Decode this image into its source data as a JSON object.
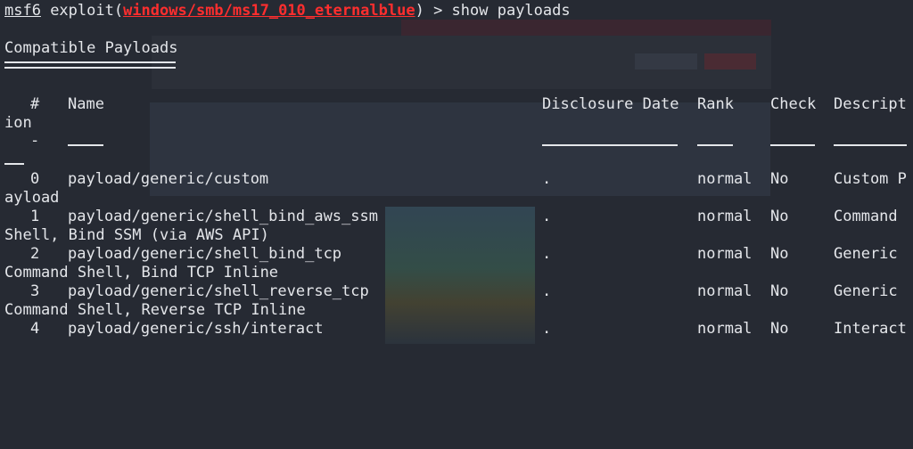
{
  "prompt": {
    "user": "msf6",
    "pre": " exploit(",
    "module": "windows/smb/ms17_010_eternalblue",
    "post": ") > ",
    "command": "show payloads"
  },
  "section_title": "Compatible Payloads",
  "columns": {
    "num": "#",
    "name": "Name",
    "date": "Disclosure Date",
    "rank": "Rank",
    "check": "Check",
    "desc": "Descript",
    "desc_wrap": "ion"
  },
  "sep_minus": "-",
  "rows": [
    {
      "num": "0",
      "name": "payload/generic/custom",
      "date": ".",
      "rank": "normal",
      "check": "No",
      "desc": "Custom P",
      "desc_wrap": "ayload"
    },
    {
      "num": "1",
      "name": "payload/generic/shell_bind_aws_ssm",
      "date": ".",
      "rank": "normal",
      "check": "No",
      "desc": "Command",
      "desc_wrap": "Shell, Bind SSM (via AWS API)"
    },
    {
      "num": "2",
      "name": "payload/generic/shell_bind_tcp",
      "date": ".",
      "rank": "normal",
      "check": "No",
      "desc": "Generic",
      "desc_wrap": "Command Shell, Bind TCP Inline"
    },
    {
      "num": "3",
      "name": "payload/generic/shell_reverse_tcp",
      "date": ".",
      "rank": "normal",
      "check": "No",
      "desc": "Generic",
      "desc_wrap": "Command Shell, Reverse TCP Inline"
    },
    {
      "num": "4",
      "name": "payload/generic/ssh/interact",
      "date": ".",
      "rank": "normal",
      "check": "No",
      "desc": "Interact",
      "desc_wrap": ""
    }
  ]
}
